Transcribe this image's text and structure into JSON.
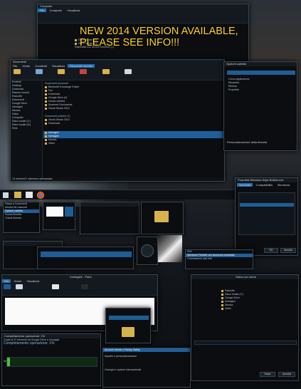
{
  "banner": {
    "line1": "NEW 2014 VERSION AVAILABLE,",
    "line2": "PLEASE SEE INFO!!!"
  },
  "colors": {
    "accent": "#1f5f9a",
    "headline": "#ffd21c",
    "progress": "#4fbf3a",
    "folder": "#d8b24a"
  },
  "explorer_top": {
    "title": "Computer",
    "tabs": [
      "File",
      "Computer",
      "Visualizza"
    ],
    "items": [
      "Disco locale (C:)",
      "Disco locale (D:)"
    ],
    "section": "Dispositivi con archivi rimovibili (1)"
  },
  "explorer_main": {
    "title": "Documenti",
    "tabs": [
      "File",
      "Home",
      "Condividi",
      "Visualizza",
      "Strumenti raccolta"
    ],
    "ribbon_groups": [
      "Appunti",
      "Organizza",
      "Nuovo",
      "Apri",
      "Seleziona"
    ],
    "nav": [
      "Preferiti",
      "Desktop",
      "Download",
      "Risorse recenti",
      "Raccolte",
      "Documenti",
      "Google Drive",
      "Immagini",
      "Musica",
      "Video",
      "Computer",
      "Disco locale (C:)",
      "Disco locale (D:)",
      "Rete"
    ],
    "group1": "Documenti personali",
    "group2": "Documenti pubblici (1)",
    "files": [
      "Bluetooth Exchange Folder",
      "Fax",
      "Download",
      "Google Drive (2)",
      "Nuova cartella",
      "Scanned Documents",
      "Visual Studio 2012",
      "Visual Studio 2013",
      "Download",
      "Immagini",
      "Immagini",
      "Musica",
      "Video"
    ],
    "selected_index": 7,
    "status": "13 elementi   1 elemento selezionato"
  },
  "settings_panel": {
    "title": "Opzioni cartella",
    "items": [
      "Cerca applicazioni",
      "Rinomina",
      "Elimina",
      "Proprietà"
    ],
    "footer": "Personalizzazione della finestra"
  },
  "taskbar": {
    "label": "Start"
  },
  "properties": {
    "title": "Proprietà Windows Style Builder.exe",
    "tabs": [
      "Generale",
      "Compatibilità",
      "Sicurezza",
      "Dettagli",
      "Versioni precedenti"
    ],
    "ok": "OK",
    "cancel": "Annulla",
    "apply": "Applica"
  },
  "context_menu": {
    "items": [
      "Passa a Documenti",
      "Mostra file nascosti",
      "Opzioni cartella",
      "Nuova finestra",
      "Chiudi finestra"
    ]
  },
  "wifi_panel": {
    "title": "Reti",
    "items": [
      "Windows Firewall con sicurezza avanzata",
      "Connessione alla rete",
      "Impostazioni"
    ]
  },
  "paint": {
    "title": "Immagine - Paint",
    "tabs": [
      "File",
      "Home",
      "Visualizza"
    ],
    "groups": [
      "Appunti",
      "Immagine",
      "Strumenti",
      "Forme",
      "Colori"
    ],
    "status": "100%"
  },
  "copy_dialog": {
    "title": "Completamento operazione: 1%",
    "line1": "Copia di 37 elementi da Google Drive a Immagini",
    "line2": "Completamento operazione: 1%",
    "line3": "Velocità: 56,7 MB/s"
  },
  "start_menu": {
    "title": "Salva con nome",
    "items": [
      "Raccolte",
      "Disco locale (C:)",
      "Google Drive",
      "Immagini",
      "Musica",
      "Video"
    ],
    "save": "Salva",
    "cancel": "Annulla"
  },
  "popup_list": {
    "items": [
      "Account utente e Family Safety",
      "Aspetto e personalizzazione",
      "Orologio e opzioni internazionali"
    ]
  }
}
